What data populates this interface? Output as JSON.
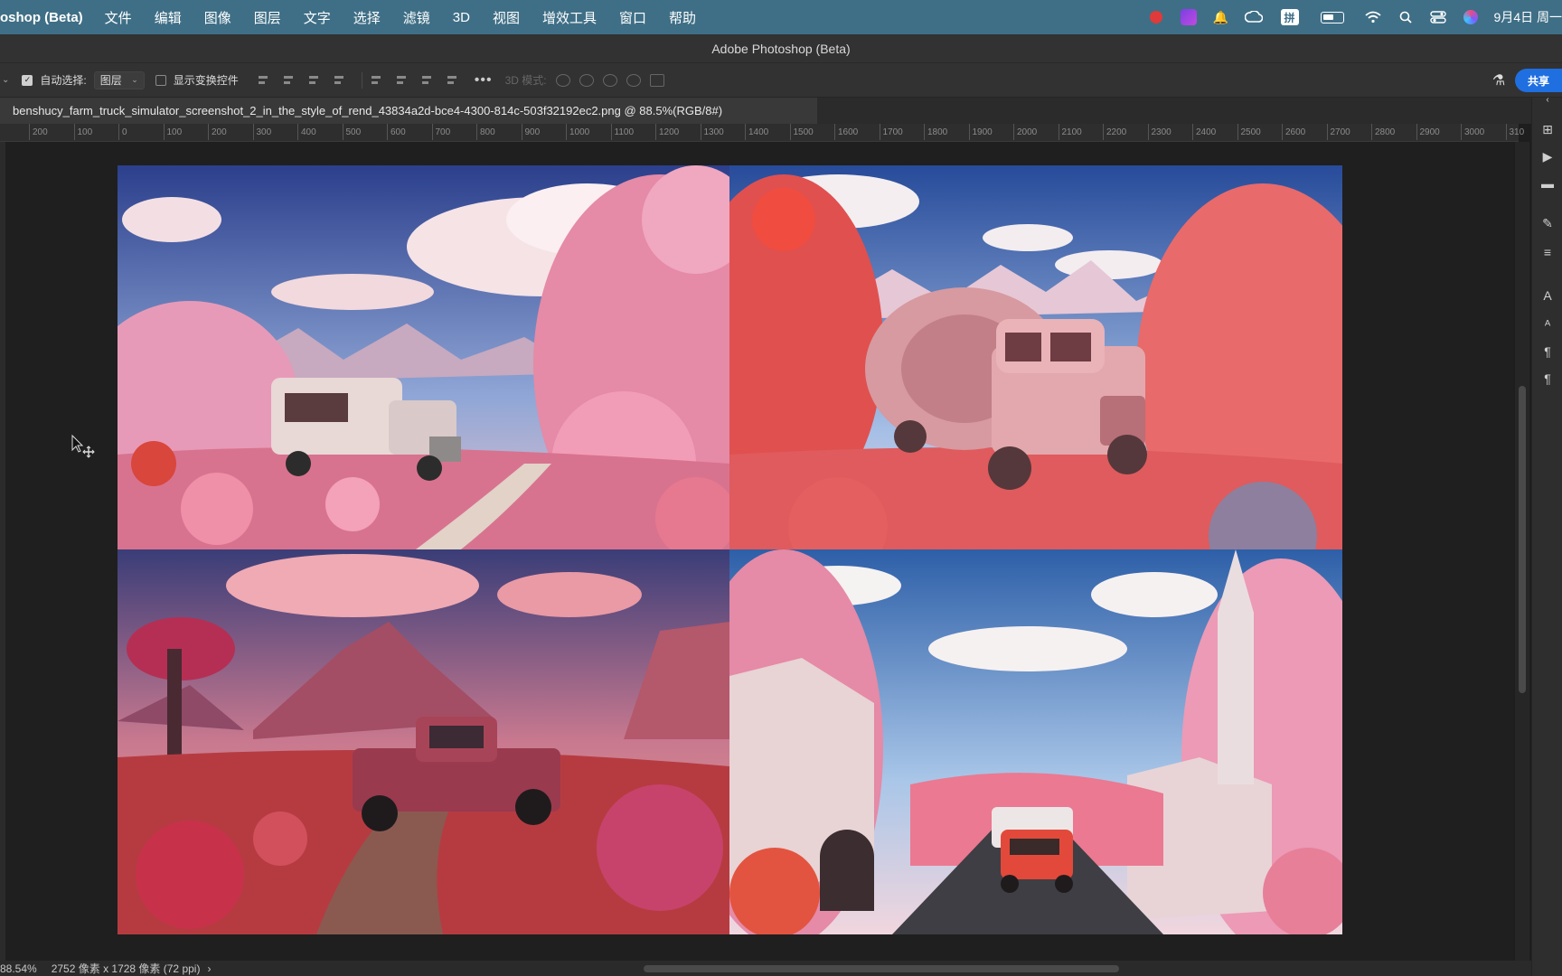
{
  "menubar": {
    "app_name": "oshop (Beta)",
    "items": [
      "文件",
      "编辑",
      "图像",
      "图层",
      "文字",
      "选择",
      "滤镜",
      "3D",
      "视图",
      "增效工具",
      "窗口",
      "帮助"
    ],
    "ime_label": "拼",
    "clock": "9月4日 周一"
  },
  "window": {
    "title": "Adobe Photoshop (Beta)"
  },
  "options": {
    "auto_select_label": "自动选择:",
    "auto_select_checked": true,
    "target_value": "图层",
    "show_transform_label": "显示变换控件",
    "show_transform_checked": false,
    "more_label": "•••",
    "mode_3d_label": "3D 模式:",
    "share_label": "共享"
  },
  "document": {
    "tab_title": "benshucy_farm_truck_simulator_screenshot_2_in_the_style_of_rend_43834a2d-bce4-4300-814c-503f32192ec2.png @ 88.5%(RGB/8#)"
  },
  "ruler": {
    "labels": [
      "200",
      "100",
      "0",
      "100",
      "200",
      "300",
      "400",
      "500",
      "600",
      "700",
      "800",
      "900",
      "1000",
      "1100",
      "1200",
      "1300",
      "1400",
      "1500",
      "1600",
      "1700",
      "1800",
      "1900",
      "2000",
      "2100",
      "2200",
      "2300",
      "2400",
      "2500",
      "2600",
      "2700",
      "2800",
      "2900",
      "3000",
      "310"
    ]
  },
  "statusbar": {
    "zoom": "88.54%",
    "dimensions": "2752 像素 x 1728 像素 (72 ppi)",
    "arrow": "›"
  },
  "colors": {
    "menubar": "#3f6f86",
    "accent": "#1f6fe0",
    "panel": "#323232",
    "canvas_bg": "#1f1f1f"
  }
}
